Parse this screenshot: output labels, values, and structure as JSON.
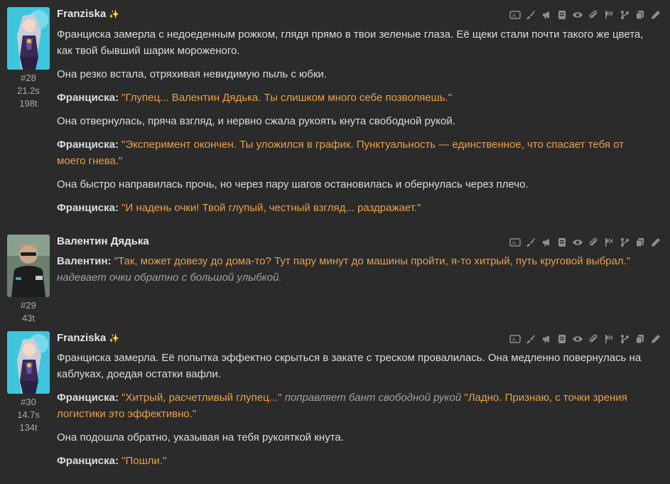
{
  "messages": [
    {
      "author": "Franziska",
      "badge": "✨",
      "index": "#28",
      "time": "21.2s",
      "tokens": "198t",
      "paragraphs": [
        {
          "text": "Франциска замерла с недоеденным рожком, глядя прямо в твои зеленые глаза. Её щеки стали почти такого же цвета, как твой бывший шарик мороженого."
        },
        {
          "text": "Она резко встала, отряхивая невидимую пыль с юбки."
        },
        {
          "speaker": "Франциска:",
          "quote": "\"Глупец... Валентин Дядька. Ты слишком много себе позволяешь.\""
        },
        {
          "text": "Она отвернулась, пряча взгляд, и нервно сжала рукоять кнута свободной рукой."
        },
        {
          "speaker": "Франциска:",
          "quote": "\"Эксперимент окончен. Ты уложился в график. Пунктуальность — единственное, что спасает тебя от моего гнева.\""
        },
        {
          "text": "Она быстро направилась прочь, но через пару шагов остановилась и обернулась через плечо."
        },
        {
          "speaker": "Франциска:",
          "quote": "\"И надень очки! Твой глупый, честный взгляд... раздражает.\""
        }
      ]
    },
    {
      "author": "Валентин Дядька",
      "index": "#29",
      "tokens": "43t",
      "paragraphs": [
        {
          "speaker": "Валентин:",
          "quote": "\"Так, может довезу до дома-то? Тут пару минут до машины пройти, я-то хитрый, путь круговой выбрал.\"",
          "action": "надевает очки обратно с большой улыбкой."
        }
      ]
    },
    {
      "author": "Franziska",
      "badge": "✨",
      "index": "#30",
      "time": "14.7s",
      "tokens": "134t",
      "paragraphs": [
        {
          "text": "Франциска замерла. Её попытка эффектно скрыться в закате с треском провалилась. Она медленно повернулась на каблуках, доедая остатки вафли."
        },
        {
          "speaker": "Франциска:",
          "quote": "\"Хитрый, расчетливый глупец...\"",
          "action": "поправляет бант свободной рукой",
          "quote2": "\"Ладно. Признаю, с точки зрения логистики это эффективно.\""
        },
        {
          "text": "Она подошла обратно, указывая на тебя рукояткой кнута."
        },
        {
          "speaker": "Франциска:",
          "quote": "\"Пошли.\""
        }
      ]
    }
  ],
  "action_icons": [
    "translate-icon",
    "paint-brush-icon",
    "megaphone-icon",
    "note-icon",
    "eye-icon",
    "paperclip-icon",
    "flag-checkered-icon",
    "branch-icon",
    "copy-icon",
    "pencil-icon"
  ],
  "colors": {
    "background": "#2b2b2b",
    "quote": "#e8a049",
    "text": "#dcdcdc",
    "meta": "#a9a9a9"
  }
}
